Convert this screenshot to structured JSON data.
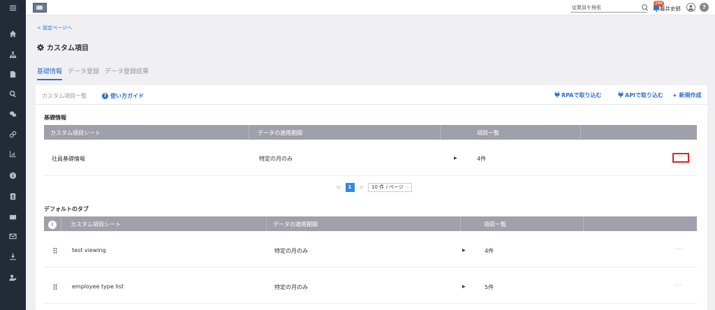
{
  "header": {
    "search_placeholder": "従業員を検索",
    "notification_count": "286",
    "username": "藤井史郎",
    "help": "?"
  },
  "nav": {
    "icons": [
      "menu-icon",
      "home-icon",
      "org-chart-icon",
      "document-icon",
      "search-icon",
      "chat-icon",
      "link-icon",
      "chart-icon",
      "info-icon",
      "id-card-icon",
      "book-icon",
      "mail-icon",
      "download-icon",
      "user-settings-icon"
    ]
  },
  "page": {
    "back_link": "< 設定ページへ",
    "title": "カスタム項目",
    "tabs": [
      {
        "label": "基礎情報",
        "active": true
      },
      {
        "label": "データ登録",
        "active": false
      },
      {
        "label": "データ登録結果",
        "active": false
      }
    ]
  },
  "card": {
    "list_label": "カスタム項目一覧",
    "guide_label": "使い方ガイド",
    "rpa_label": "RPAで取り込む",
    "api_label": "APIで取り込む",
    "new_label": "+ 新規作成"
  },
  "basic": {
    "title": "基礎情報",
    "columns": [
      "カスタム項目シート",
      "データの適用期間",
      "項目一覧"
    ],
    "rows": [
      {
        "name": "社員基礎情報",
        "period": "特定の月のみ",
        "count": "4件",
        "more": "···"
      }
    ]
  },
  "pager": {
    "prev": "<",
    "page": "1",
    "next": ">",
    "size": "10 件 / ページ"
  },
  "default_tab": {
    "title": "デフォルトのタブ",
    "columns": [
      "カスタム項目シート",
      "データの適用期間",
      "項目一覧"
    ],
    "rows": [
      {
        "name": "test viewing",
        "period": "特定の月のみ",
        "count": "4件",
        "more": "···"
      },
      {
        "name": "employee type list",
        "period": "特定の月のみ",
        "count": "5件",
        "more": "···"
      }
    ]
  },
  "colors": {
    "accent": "#2e6fd1",
    "nav_bg": "#222b38",
    "table_header": "#9ea0ac",
    "highlight": "#e02020"
  }
}
